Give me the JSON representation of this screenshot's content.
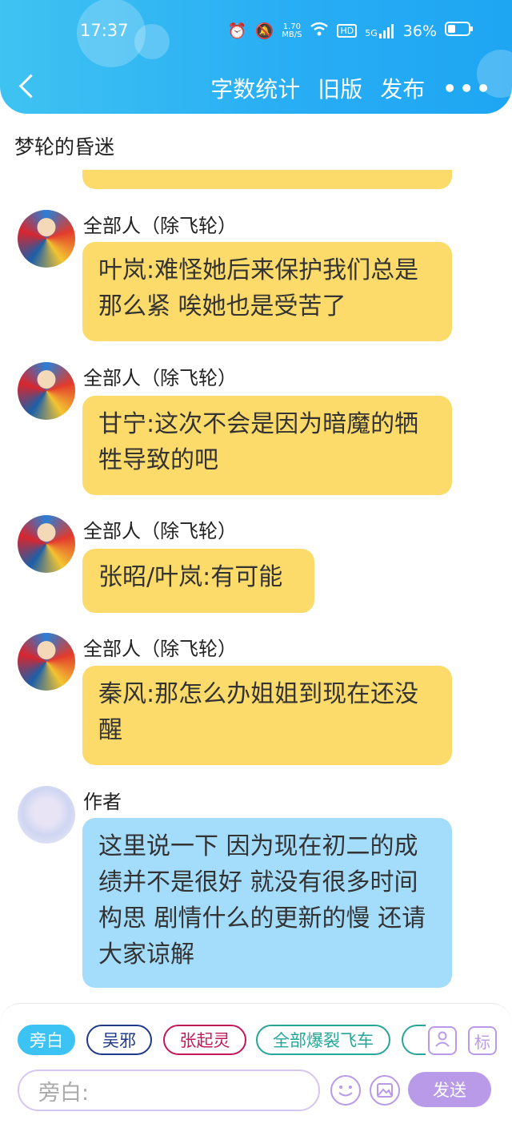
{
  "status_bar": {
    "time": "17:37",
    "speed_value": "1.70",
    "speed_unit": "MB/S",
    "hd": "HD",
    "network": "5G",
    "battery": "36%"
  },
  "header": {
    "nav": [
      "字数统计",
      "旧版",
      "发布"
    ],
    "more": "•••"
  },
  "story_title": "梦轮的昏迷",
  "messages": [
    {
      "sender": "全部人（除飞轮）",
      "text": "叶岚:难怪她后来保护我们总是那么紧 唉她也是受苦了",
      "avatar": "anime-group-avatar"
    },
    {
      "sender": "全部人（除飞轮）",
      "text": "甘宁:这次不会是因为暗魔的牺牲导致的吧",
      "avatar": "anime-group-avatar"
    },
    {
      "sender": "全部人（除飞轮）",
      "text": "张昭/叶岚:有可能",
      "avatar": "anime-group-avatar"
    },
    {
      "sender": "全部人（除飞轮）",
      "text": "秦风:那怎么办姐姐到现在还没醒",
      "avatar": "anime-group-avatar"
    },
    {
      "sender": "作者",
      "text": "这里说一下 因为现在初二的成绩并不是很好 就没有很多时间构思 剧情什么的更新的慢 还请大家谅解",
      "avatar": "author-avatar"
    }
  ],
  "roles": [
    "旁白",
    "吴邪",
    "张起灵",
    "全部爆裂飞车"
  ],
  "role_colors": {
    "active": "#3cc2f3",
    "wuxie": "#1f3a8a",
    "zhangqiling": "#c2185b",
    "feiche": "#26a69a"
  },
  "tools": {
    "role_icon": "person-icon",
    "tag_label": "标"
  },
  "input": {
    "placeholder": "旁白:"
  },
  "send_label": "发送"
}
